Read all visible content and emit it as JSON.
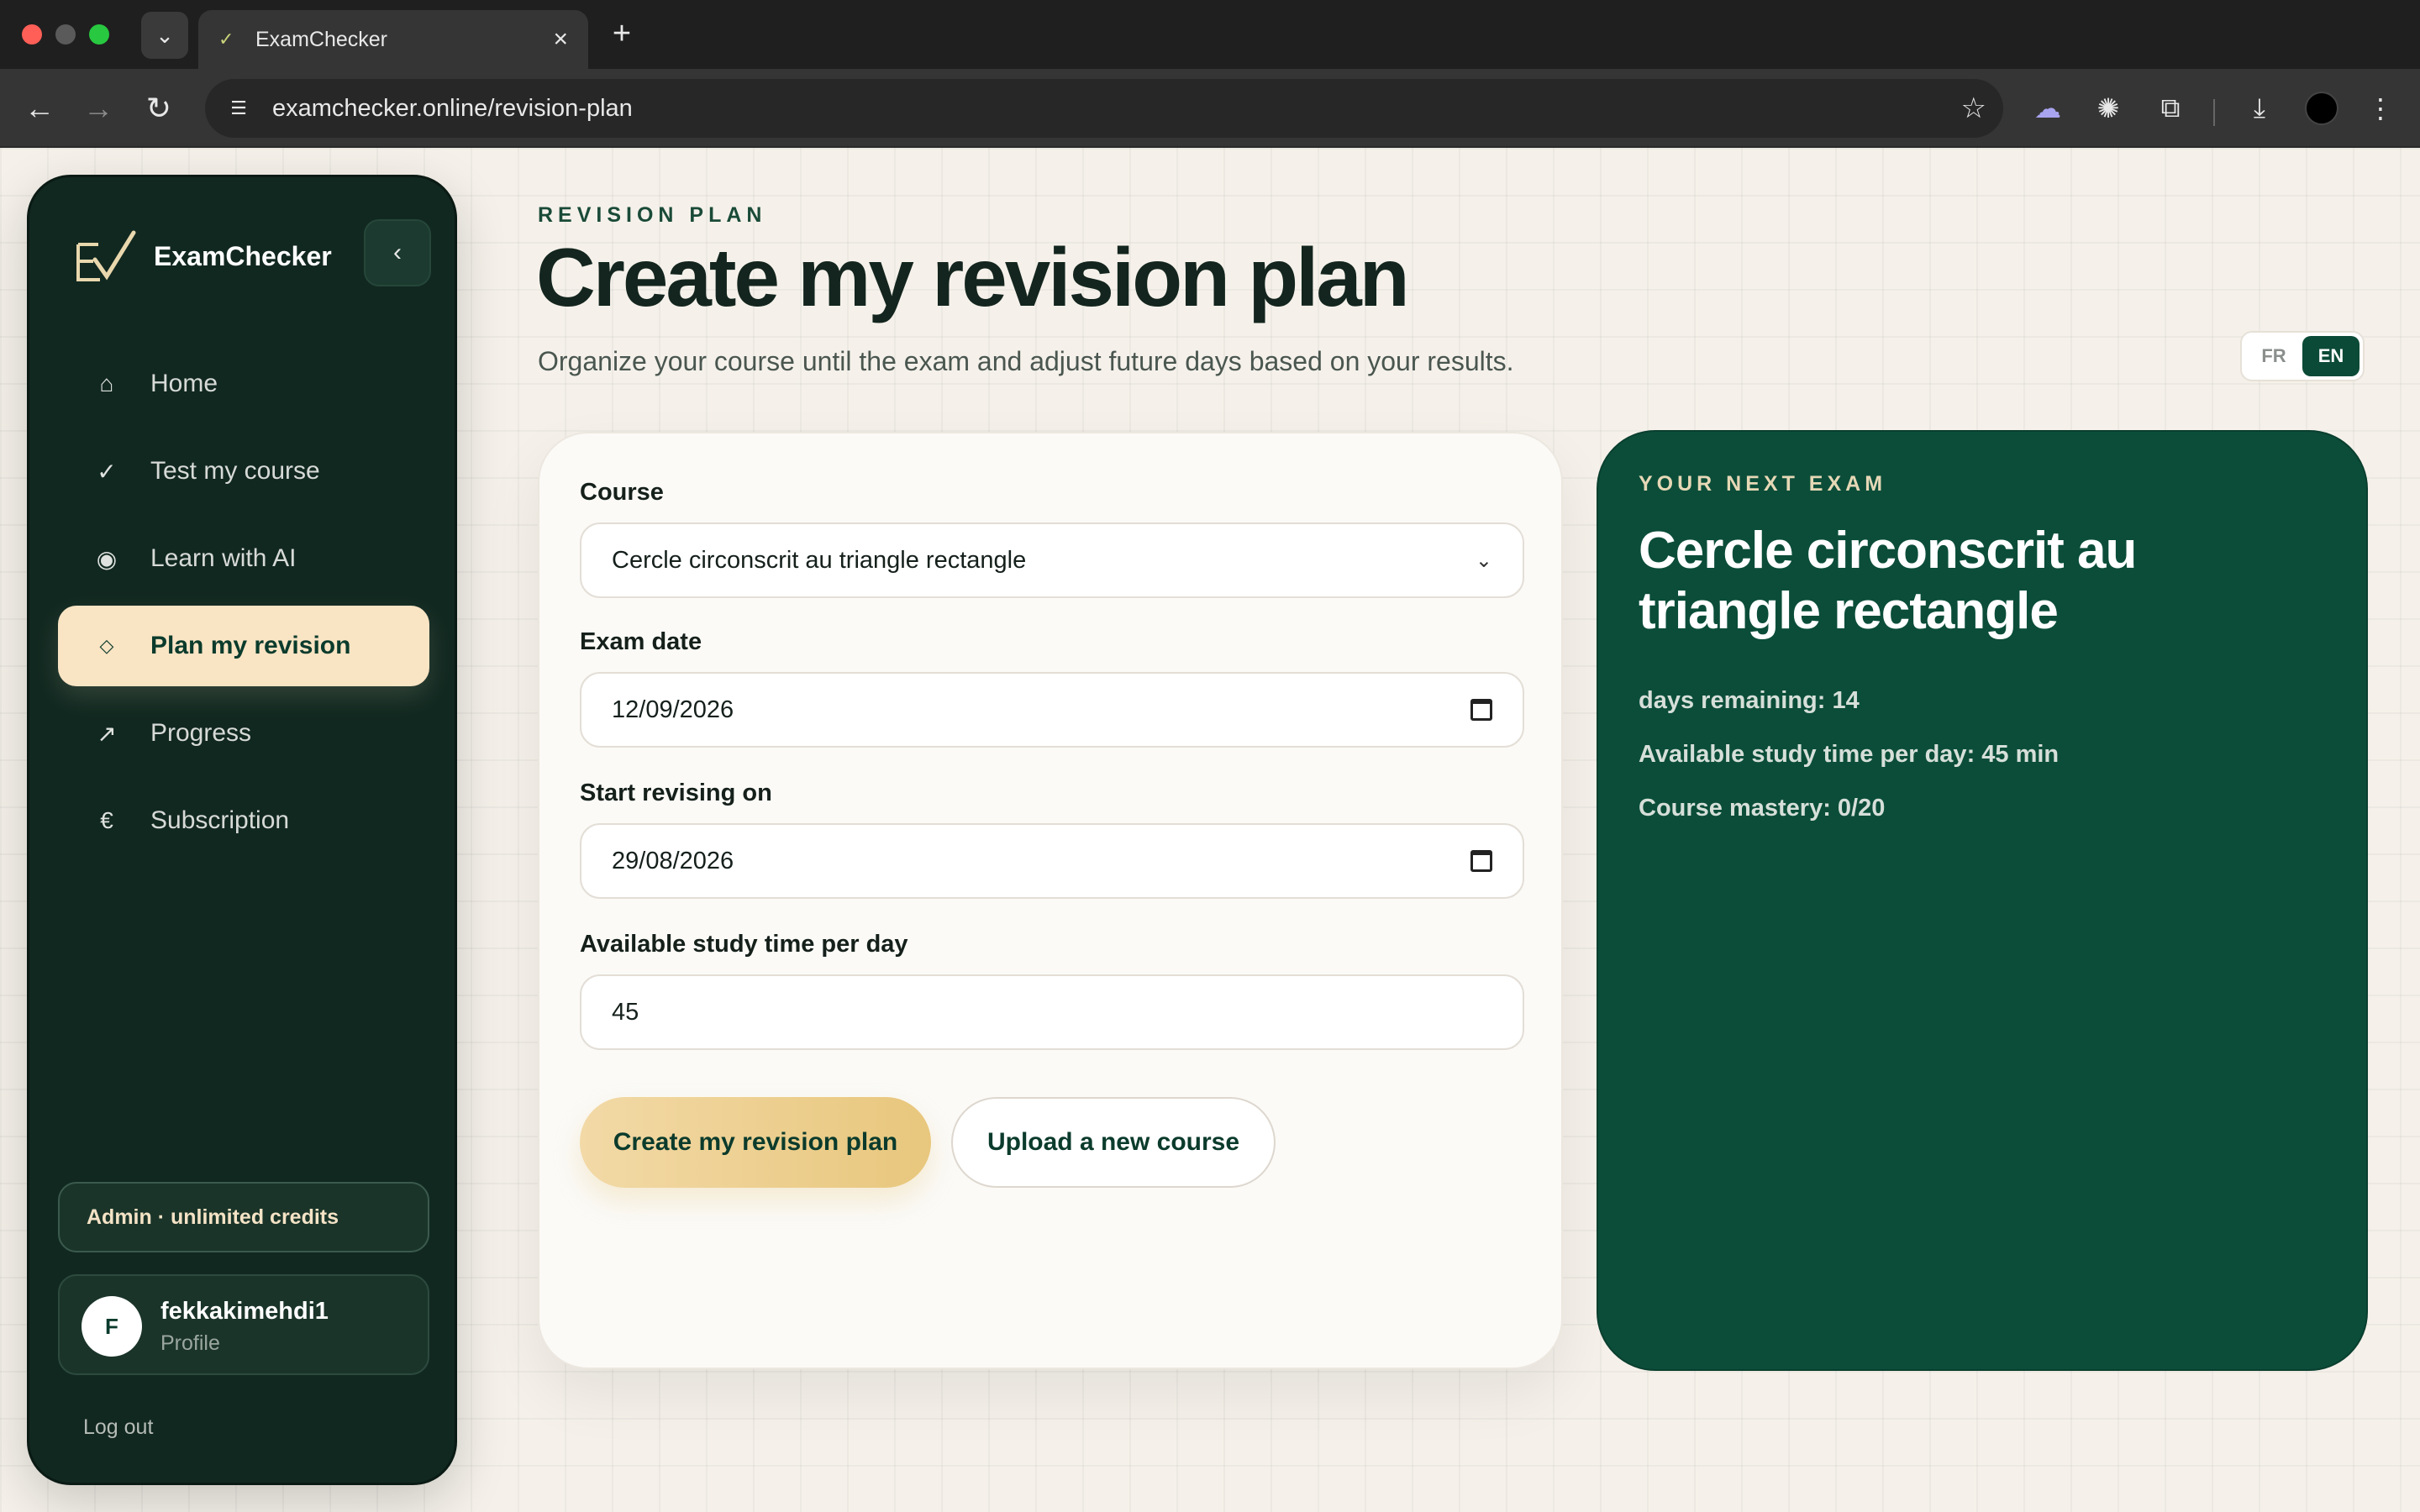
{
  "browser": {
    "tab_title": "ExamChecker",
    "url": "examchecker.online/revision-plan"
  },
  "sidebar": {
    "brand": "ExamChecker",
    "items": [
      {
        "label": "Home",
        "icon": "home-icon"
      },
      {
        "label": "Test my course",
        "icon": "check-icon"
      },
      {
        "label": "Learn with AI",
        "icon": "radio-icon"
      },
      {
        "label": "Plan my revision",
        "icon": "diamond-icon",
        "active": true
      },
      {
        "label": "Progress",
        "icon": "arrow-up-right-icon"
      },
      {
        "label": "Subscription",
        "icon": "euro-icon"
      }
    ],
    "credits": "Admin · unlimited credits",
    "profile": {
      "initial": "F",
      "name": "fekkakimehdi1",
      "sub": "Profile"
    },
    "logout": "Log out"
  },
  "header": {
    "eyebrow": "REVISION PLAN",
    "title": "Create my revision plan",
    "subtitle": "Organize your course until the exam and adjust future days based on your results."
  },
  "lang": {
    "fr": "FR",
    "en": "EN",
    "active": "EN"
  },
  "form": {
    "course_label": "Course",
    "course_value": "Cercle circonscrit au triangle rectangle",
    "exam_date_label": "Exam date",
    "exam_date_value": "12/09/2026",
    "start_label": "Start revising on",
    "start_value": "29/08/2026",
    "study_time_label": "Available study time per day",
    "study_time_value": "45",
    "create_button": "Create my revision plan",
    "upload_button": "Upload a new course"
  },
  "exam": {
    "eyebrow": "YOUR NEXT EXAM",
    "title": "Cercle circonscrit au triangle rectangle",
    "days_remaining": "days remaining: 14",
    "study_time": "Available study time per day: 45 min",
    "mastery": "Course mastery: 0/20"
  },
  "colors": {
    "sidebar_bg": "#112820",
    "accent_green": "#0b4d39",
    "accent_gold": "#e8c77d",
    "active_nav_bg": "#f9e4c4"
  }
}
